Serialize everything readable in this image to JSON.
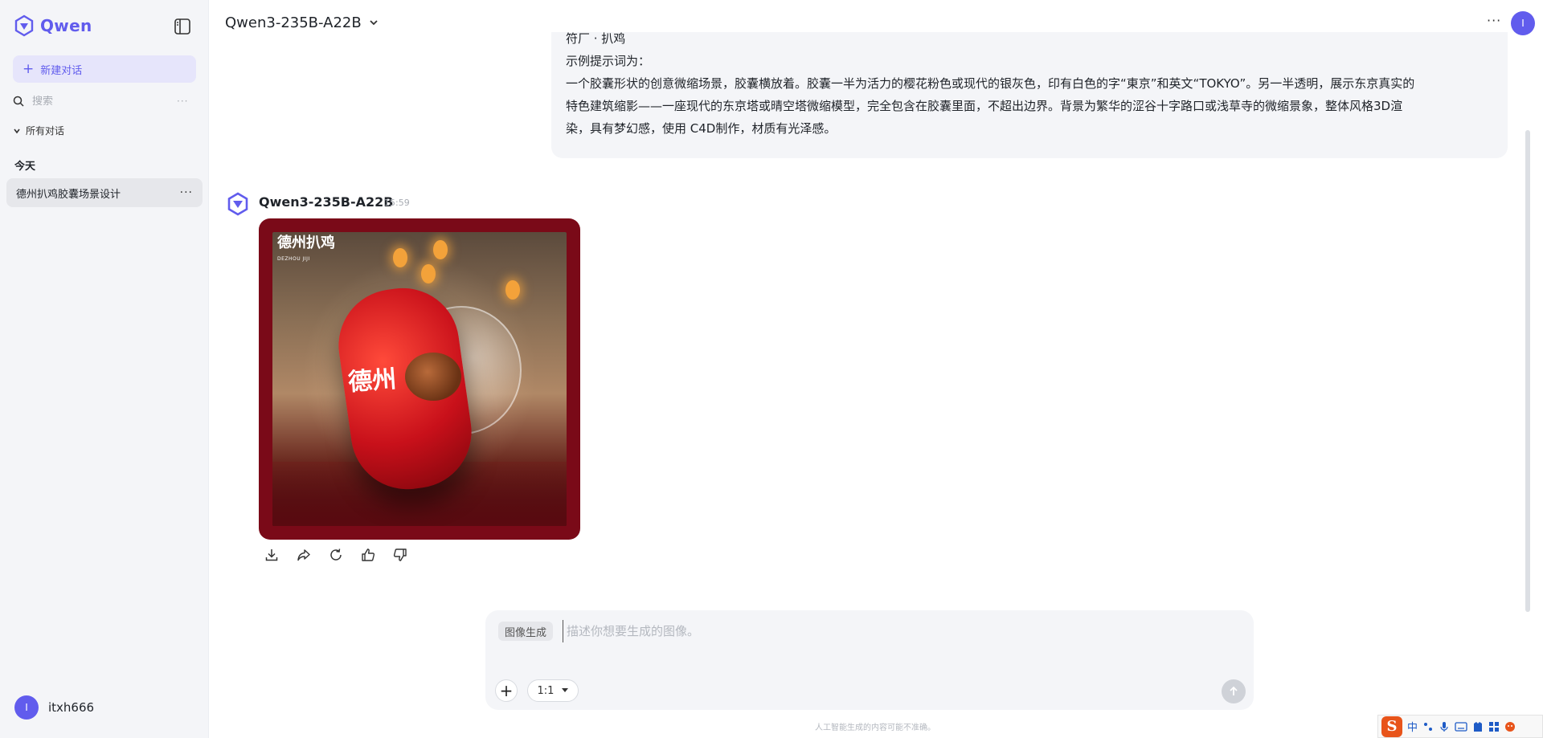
{
  "sidebar": {
    "logo_text": "Qwen",
    "new_chat_label": "新建对话",
    "search_placeholder": "搜索",
    "all_chats_label": "所有对话",
    "section_today": "今天",
    "chats": [
      {
        "title": "德州扒鸡胶囊场景设计"
      }
    ],
    "user": {
      "avatar_letter": "I",
      "name": "itxh666"
    }
  },
  "header": {
    "model_name": "Qwen3-235B-A22B",
    "avatar_letter": "I"
  },
  "user_message": {
    "cut_line": "符厂 · 扒鸡",
    "lines": [
      "示例提示词为：",
      "一个胶囊形状的创意微缩场景，胶囊横放着。胶囊一半为活力的樱花粉色或现代的银灰色，印有白色的字“東京”和英文“TOKYO”。另一半透明，展示东京真实的",
      "特色建筑缩影——一座现代的东京塔或晴空塔微缩模型，完全包含在胶囊里面，不超出边界。背景为繁华的涩谷十字路口或浅草寺的微缩景象，整体风格3D渲",
      "染，具有梦幻感，使用 C4D制作，材质有光泽感。"
    ]
  },
  "assistant_message": {
    "model_name": "Qwen3-235B-A22B",
    "time": "15:59",
    "image": {
      "logo_text": "德州扒鸡",
      "logo_sub": "DEZHOU JIJI",
      "capsule_text": "德州"
    },
    "actions": [
      "download-icon",
      "share-icon",
      "regenerate-icon",
      "thumbs-up-icon",
      "thumbs-down-icon"
    ]
  },
  "composer": {
    "mode_tag": "图像生成",
    "placeholder": "描述你想要生成的图像。",
    "ratio": "1:1"
  },
  "disclaimer": "人工智能生成的内容可能不准确。",
  "ime": {
    "logo": "S",
    "lang": "中"
  },
  "colors": {
    "accent": "#615ced",
    "sidebar_bg": "#f4f5f8",
    "image_frame": "#7a0a18"
  }
}
